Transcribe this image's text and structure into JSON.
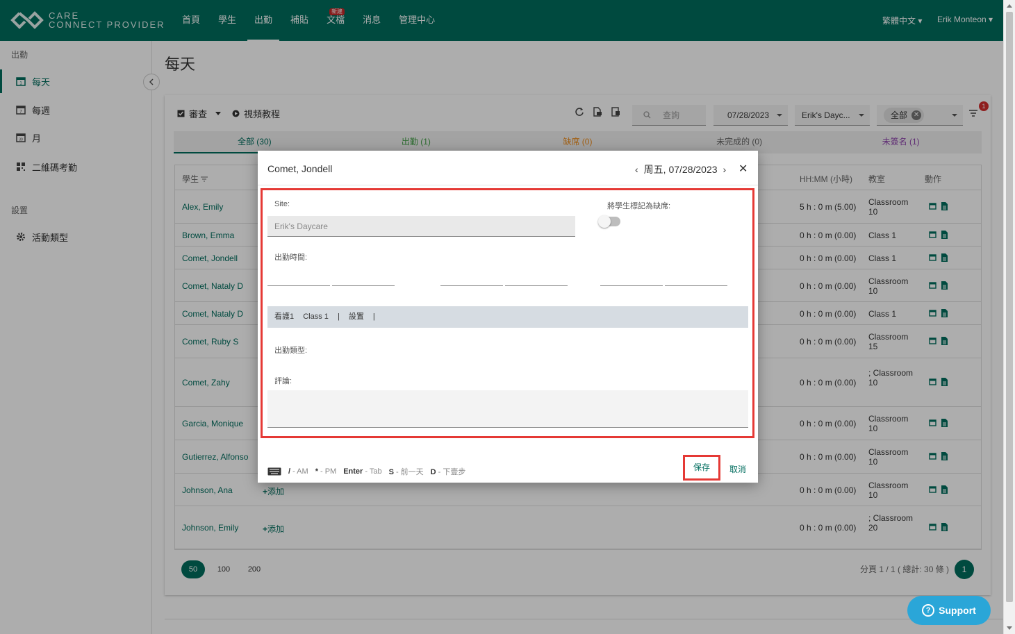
{
  "app": {
    "logo_line1": "CARE",
    "logo_line2": "CONNECT PROVIDER",
    "nav": [
      {
        "label": "首頁",
        "active": false
      },
      {
        "label": "學生",
        "active": false
      },
      {
        "label": "出勤",
        "active": true
      },
      {
        "label": "補貼",
        "active": false
      },
      {
        "label": "文檔",
        "active": false,
        "badge": "新建"
      },
      {
        "label": "消息",
        "active": false
      },
      {
        "label": "管理中心",
        "active": false
      }
    ],
    "language": "繁體中文 ▾",
    "user": "Erik Monteon ▾",
    "brand_color": "#006d5e"
  },
  "sidebar": {
    "section_attendance": "出勤",
    "items": [
      {
        "label": "每天",
        "icon": "calendar-day-icon",
        "active": true
      },
      {
        "label": "每週",
        "icon": "calendar-week-icon",
        "active": false
      },
      {
        "label": "月",
        "icon": "calendar-month-icon",
        "active": false
      },
      {
        "label": "二維碼考勤",
        "icon": "qr-code-icon",
        "active": false
      }
    ],
    "section_settings": "設置",
    "settings_items": [
      {
        "label": "活動類型",
        "icon": "gear-icon"
      }
    ]
  },
  "page": {
    "title": "每天",
    "toolbar": {
      "review_label": "審查",
      "video_label": "視頻教程",
      "search_placeholder": "查詢",
      "date_value": "07/28/2023",
      "site_value": "Erik's Dayc...",
      "filter_chip": "全部",
      "filter_badge": "1"
    },
    "tabs": [
      {
        "label": "全部 (30)",
        "color": "#006d5e",
        "active": true
      },
      {
        "label": "出勤 (1)",
        "color": "#43a047",
        "active": false
      },
      {
        "label": "缺席 (0)",
        "color": "#ef8c1b",
        "active": false
      },
      {
        "label": "未完成的 (0)",
        "color": "#666666",
        "active": false
      },
      {
        "label": "未簽名 (1)",
        "color": "#8e44ad",
        "active": false
      }
    ],
    "table": {
      "headers": {
        "student": "學生",
        "hours": "HH:MM (小時)",
        "classroom": "教室",
        "action": "動作"
      },
      "rows": [
        {
          "name": "Alex, Emily",
          "hours": "5 h : 0 m (5.00)",
          "classroom": "Classroom 10",
          "add": ""
        },
        {
          "name": "Brown, Emma",
          "hours": "0 h : 0 m (0.00)",
          "classroom": "Class 1",
          "add": ""
        },
        {
          "name": "Comet, Jondell",
          "hours": "0 h : 0 m (0.00)",
          "classroom": "Class 1",
          "add": ""
        },
        {
          "name": "Comet, Nataly D",
          "hours": "0 h : 0 m (0.00)",
          "classroom": "Classroom 10",
          "add": ""
        },
        {
          "name": "Comet, Nataly D",
          "hours": "0 h : 0 m (0.00)",
          "classroom": "Class 1",
          "add": ""
        },
        {
          "name": "Comet, Ruby S",
          "hours": "0 h : 0 m (0.00)",
          "classroom": "Classroom 15",
          "add": ""
        },
        {
          "name": "Comet, Zahy",
          "hours": "0 h : 0 m (0.00)",
          "classroom": "; Classroom 10",
          "add": ""
        },
        {
          "name": "Garcia, Monique",
          "hours": "0 h : 0 m (0.00)",
          "classroom": "Classroom 10",
          "add": ""
        },
        {
          "name": "Gutierrez, Alfonso",
          "hours": "0 h : 0 m (0.00)",
          "classroom": "Classroom 10",
          "add": ""
        },
        {
          "name": "Johnson, Ana",
          "hours": "0 h : 0 m (0.00)",
          "classroom": "Classroom 10",
          "add": "添加"
        },
        {
          "name": "Johnson, Emily",
          "hours": "0 h : 0 m (0.00)",
          "classroom": "; Classroom 20",
          "add": "添加"
        }
      ]
    },
    "pagination": {
      "sizes": [
        "50",
        "100",
        "200"
      ],
      "active_size": "50",
      "info": "分頁 1 / 1 ( 總計: 30 條 )",
      "current": "1"
    }
  },
  "modal": {
    "student_name": "Comet, Jondell",
    "date": "周五, 07/28/2023",
    "site_label": "Site:",
    "site_value": "Erik's Daycare",
    "absent_label": "將學生標記為缺席:",
    "time_label": "出勤時間:",
    "care_bar": [
      "看護1",
      "Class 1",
      "|",
      "設置",
      "|"
    ],
    "type_label": "出勤類型:",
    "comment_label": "評論:",
    "shortcuts": [
      {
        "key": "/",
        "desc": "- AM"
      },
      {
        "key": "*",
        "desc": "- PM"
      },
      {
        "key": "Enter",
        "desc": "- Tab"
      },
      {
        "key": "S",
        "desc": "- 前一天"
      },
      {
        "key": "D",
        "desc": "- 下壹步"
      }
    ],
    "save_label": "保存",
    "cancel_label": "取消"
  },
  "support_label": "Support"
}
